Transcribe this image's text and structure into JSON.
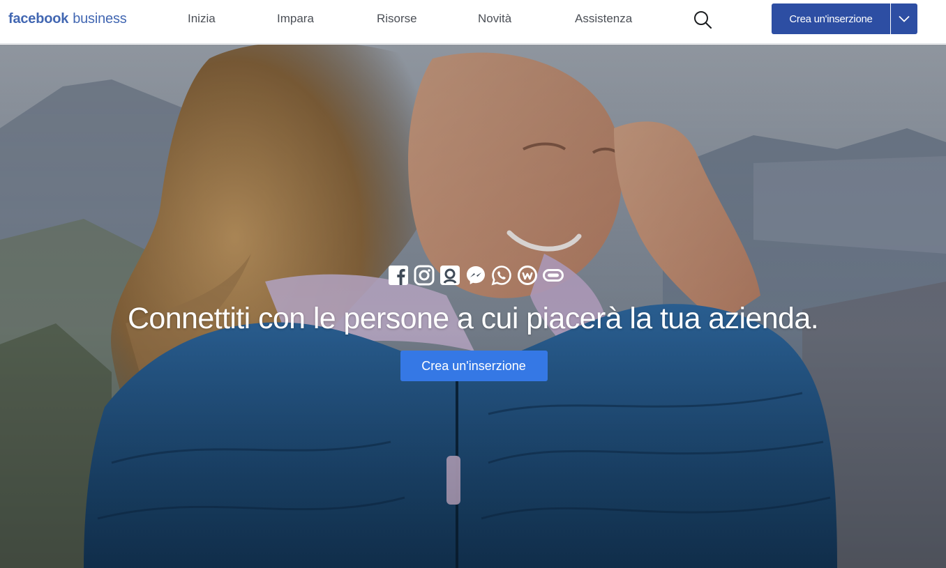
{
  "header": {
    "logo_brand": "facebook",
    "logo_suffix": "business",
    "nav": [
      "Inizia",
      "Impara",
      "Risorse",
      "Novità",
      "Assistenza"
    ],
    "cta_label": "Crea un'inserzione"
  },
  "hero": {
    "platform_icons": [
      "facebook-icon",
      "instagram-icon",
      "audience-network-icon",
      "messenger-icon",
      "whatsapp-icon",
      "workplace-icon",
      "oculus-icon"
    ],
    "headline": "Connettiti con le persone a cui piacerà la tua azienda.",
    "cta_label": "Crea un'inserzione"
  },
  "colors": {
    "brand": "#4267b2",
    "nav_cta": "#2d4ea3",
    "hero_cta": "#3578e5"
  }
}
